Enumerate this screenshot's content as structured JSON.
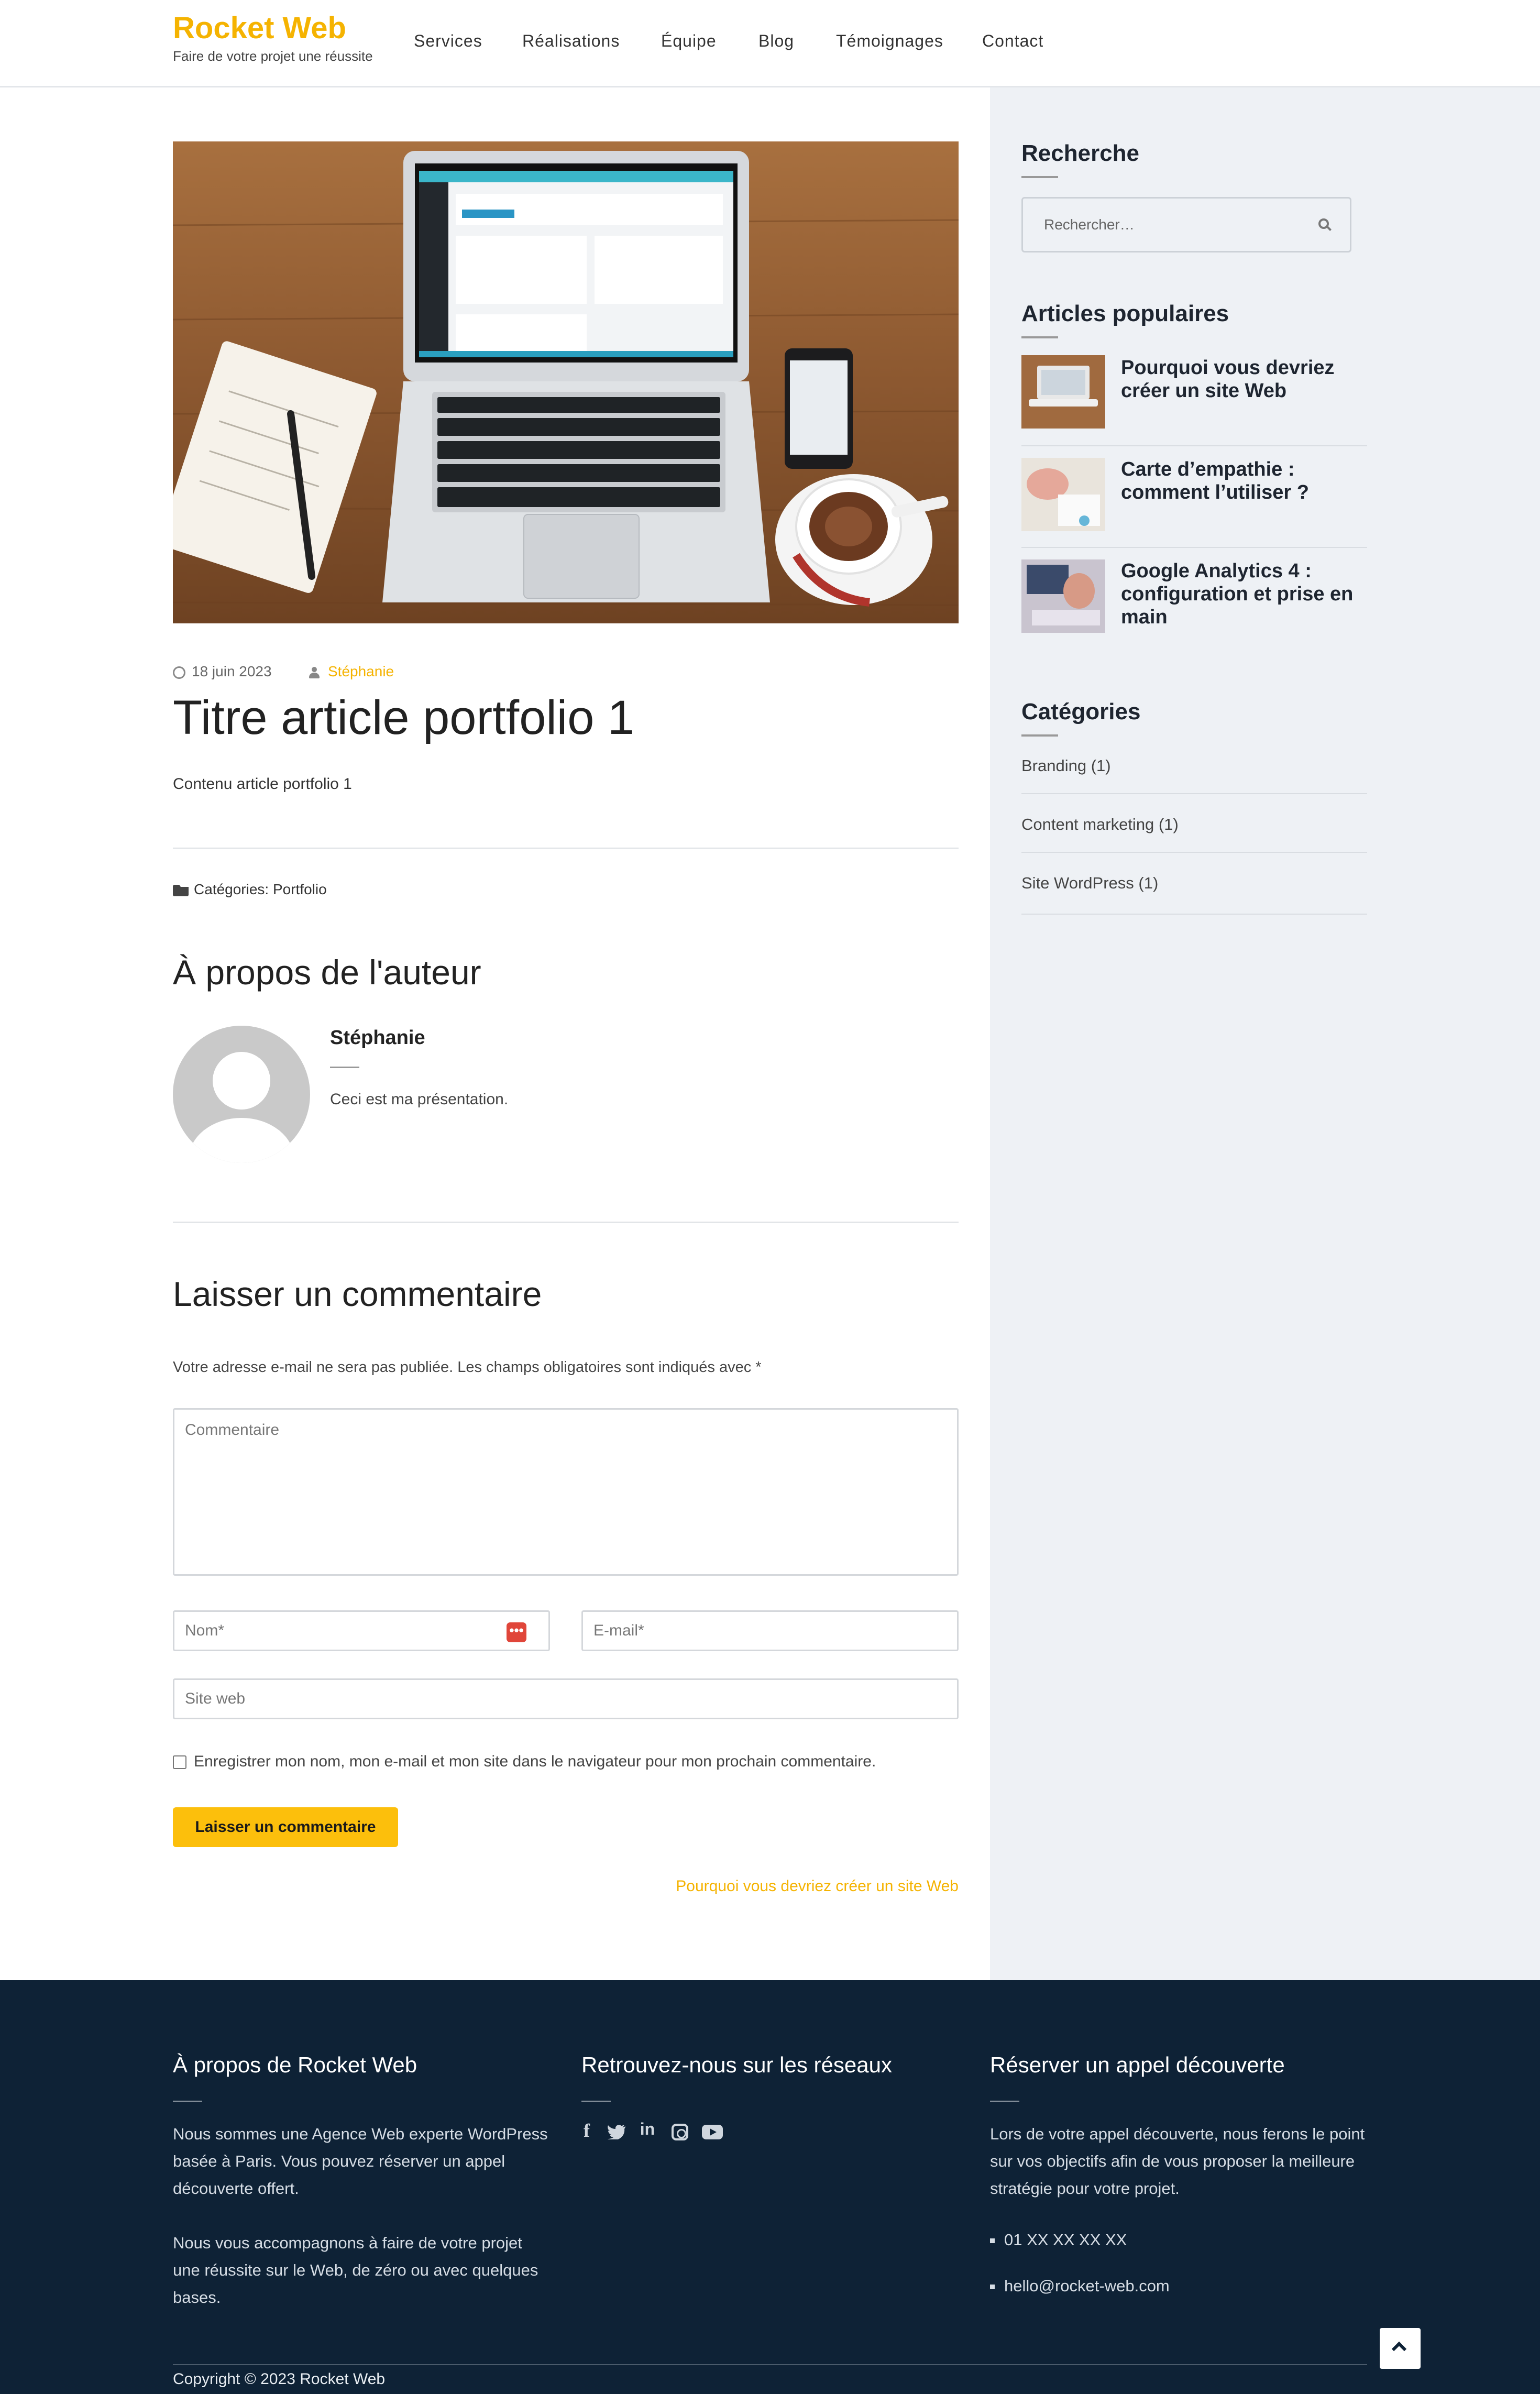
{
  "header": {
    "logo": "Rocket Web",
    "tagline": "Faire de votre projet une réussite",
    "nav": [
      "Services",
      "Réalisations",
      "Équipe",
      "Blog",
      "Témoignages",
      "Contact"
    ]
  },
  "post": {
    "date": "18 juin 2023",
    "author": "Stéphanie",
    "title": "Titre article portfolio 1",
    "content": "Contenu article portfolio 1",
    "categories_label": "Catégories:",
    "category": "Portfolio"
  },
  "author_box": {
    "title": "À propos de l'auteur",
    "name": "Stéphanie",
    "bio": "Ceci est ma présentation."
  },
  "comment_form": {
    "title": "Laisser un commentaire",
    "notice": "Votre adresse e-mail ne sera pas publiée. Les champs obligatoires sont indiqués avec *",
    "comment_placeholder": "Commentaire",
    "name_placeholder": "Nom*",
    "email_placeholder": "E-mail*",
    "url_placeholder": "Site web",
    "consent": "Enregistrer mon nom, mon e-mail et mon site dans le navigateur pour mon prochain commentaire.",
    "submit": "Laisser un commentaire"
  },
  "next_post": "Pourquoi vous devriez créer un site Web",
  "sidebar": {
    "search_title": "Recherche",
    "search_placeholder": "Rechercher…",
    "popular_title": "Articles populaires",
    "popular": [
      {
        "title": "Pourquoi vous devriez créer un site Web"
      },
      {
        "title": "Carte d’empathie : comment l’utiliser ?"
      },
      {
        "title": "Google Analytics 4 : configuration et prise en main"
      }
    ],
    "categories_title": "Catégories",
    "categories": [
      "Branding (1)",
      "Content marketing (1)",
      "Site WordPress (1)"
    ]
  },
  "footer": {
    "about_title": "À propos de Rocket Web",
    "about_p1": "Nous sommes une Agence Web experte WordPress basée à Paris. Vous pouvez réserver un appel découverte offert.",
    "about_p2": "Nous vous accompagnons à faire de votre projet une réussite sur le Web, de zéro ou avec quelques bases.",
    "social_title": "Retrouvez-nous sur les réseaux",
    "social_icons": [
      "facebook-icon",
      "twitter-icon",
      "linkedin-icon",
      "instagram-icon",
      "youtube-icon"
    ],
    "call_title": "Réserver un appel découverte",
    "call_text": "Lors de votre appel découverte, nous ferons le point sur vos objectifs afin de vous proposer la meilleure stratégie pour votre projet.",
    "phone": "01 XX XX XX XX",
    "email": "hello@rocket-web.com",
    "copyright": "Copyright © 2023 Rocket Web"
  },
  "colors": {
    "accent": "#f5b301",
    "button": "#fcbf0c",
    "footer_bg": "#0e2236",
    "sidebar_bg": "#eef1f5"
  }
}
